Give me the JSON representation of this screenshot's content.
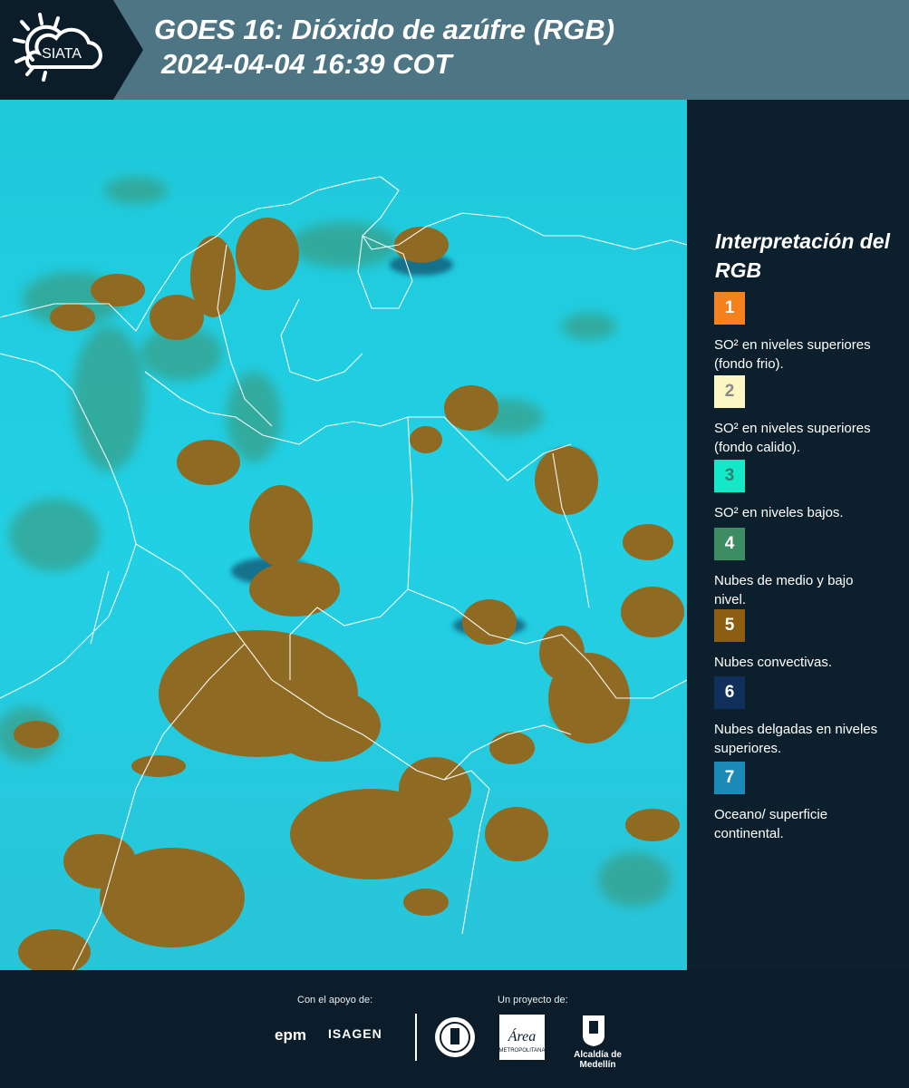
{
  "header": {
    "logo_text": "SIATA",
    "title_line1": "GOES 16: Dióxido de azúfre (RGB)",
    "title_line2": "2024-04-04 16:39 COT"
  },
  "legend": {
    "title": "Interpretación del RGB",
    "items": [
      {
        "num": "1",
        "color": "#f5821f",
        "num_color": "#ffffff",
        "text": "SO² en niveles superiores (fondo frio)."
      },
      {
        "num": "2",
        "color": "#fcf6c4",
        "num_color": "#8a8a8a",
        "text": "SO² en niveles superiores (fondo calido)."
      },
      {
        "num": "3",
        "color": "#15e8c7",
        "num_color": "#2f7f75",
        "text": "SO² en niveles bajos."
      },
      {
        "num": "4",
        "color": "#3e8c63",
        "num_color": "#ffffff",
        "text": "Nubes de medio y bajo nivel."
      },
      {
        "num": "5",
        "color": "#8c5e12",
        "num_color": "#ffffff",
        "text": "Nubes convectivas."
      },
      {
        "num": "6",
        "color": "#10305b",
        "num_color": "#ffffff",
        "text": "Nubes delgadas en niveles superiores."
      },
      {
        "num": "7",
        "color": "#1a8bb8",
        "num_color": "#ffffff",
        "text": "Oceano/ superficie continental."
      }
    ]
  },
  "footer": {
    "support_label": "Con el apoyo de:",
    "project_label": "Un proyecto de:",
    "sponsor1": "epm",
    "sponsor2": "ISAGEN",
    "partner1_text": "Área",
    "partner1_sub": "METROPOLITANA",
    "partner2": "Alcaldía de Medellín"
  }
}
